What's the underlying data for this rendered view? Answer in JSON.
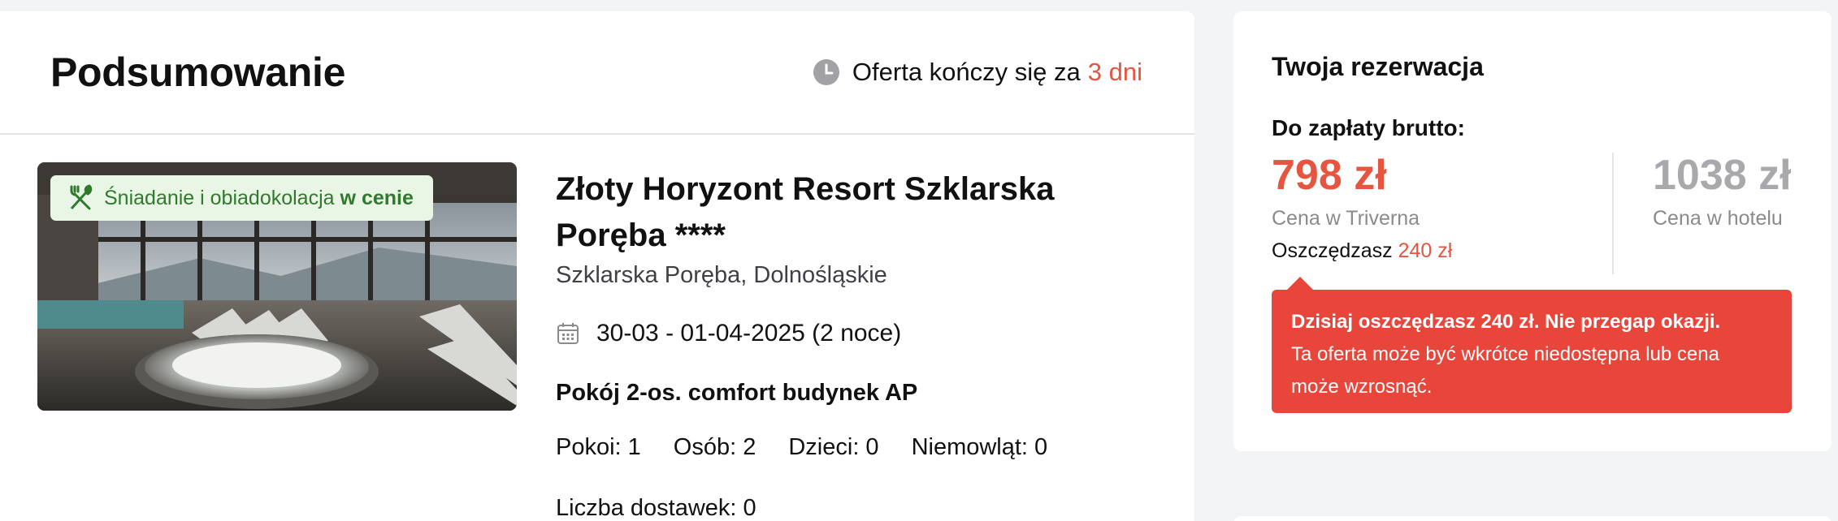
{
  "summary": {
    "title": "Podsumowanie",
    "offer_prefix": "Oferta kończy się za",
    "offer_days": "3 dni"
  },
  "hotel": {
    "badge_text": "Śniadanie i obiadokolacja",
    "badge_strong": "w cenie",
    "name": "Złoty Horyzont Resort Szklarska Poręba ****",
    "location": "Szklarska Poręba, Dolnośląskie",
    "dates": "30-03 - 01-04-2025 (2 noce)",
    "room": "Pokój 2-os. comfort budynek AP",
    "counts": {
      "rooms": "Pokoi: 1",
      "persons": "Osób: 2",
      "children": "Dzieci: 0",
      "infants": "Niemowląt: 0"
    },
    "extra_beds": "Liczba dostawek: 0"
  },
  "booking": {
    "title": "Twoja rezerwacja",
    "pay_label": "Do zapłaty brutto:",
    "price": "798 zł",
    "price_caption": "Cena w Triverna",
    "savings_prefix": "Oszczędzasz",
    "savings_amount": "240 zł",
    "hotel_price": "1038 zł",
    "hotel_price_caption": "Cena w hotelu",
    "alert_strong": "Dzisiaj oszczędzasz 240 zł. Nie przegap okazji.",
    "alert_text": "Ta oferta może być wkrótce niedostępna lub cena może wzrosnąć."
  },
  "colors": {
    "accent": "#e5553f",
    "alert_bg": "#e8463a",
    "badge_bg": "#e9f6e6",
    "badge_text": "#2f7a2c"
  },
  "icons": {
    "timer": "clock-icon",
    "meal": "cutlery-icon",
    "dates": "calendar-icon"
  }
}
